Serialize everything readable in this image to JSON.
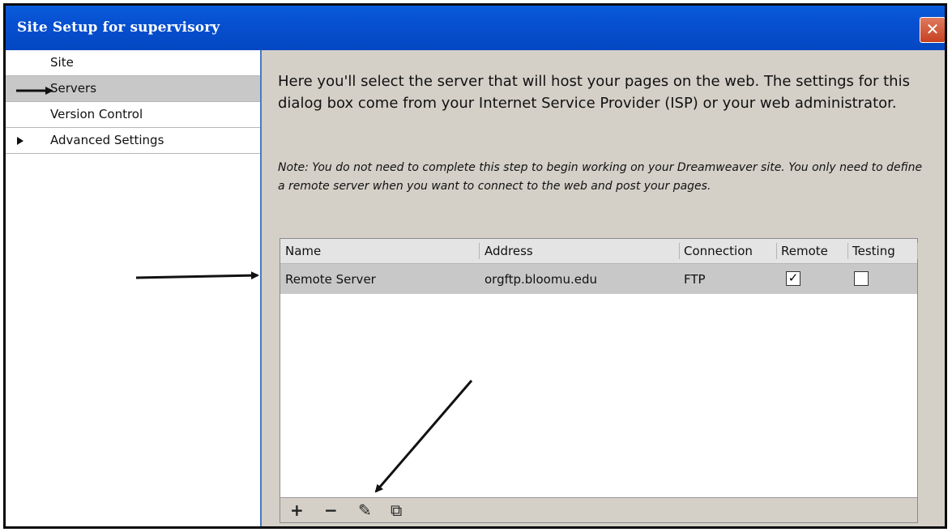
{
  "window": {
    "title": "Site Setup for supervisory",
    "close_glyph": "✕"
  },
  "sidebar": {
    "items": [
      {
        "label": "Site",
        "selected": false,
        "expander": false
      },
      {
        "label": "Servers",
        "selected": true,
        "expander": false
      },
      {
        "label": "Version Control",
        "selected": false,
        "expander": false
      },
      {
        "label": "Advanced Settings",
        "selected": false,
        "expander": true
      }
    ]
  },
  "main": {
    "intro": "Here you'll select the server that will host your pages on the web. The settings for this dialog box come from your Internet Service Provider (ISP) or your web administrator.",
    "note": "Note: You do not need to complete this step to begin working on your Dreamweaver site. You only need to define a remote server when you want to connect to the web and post your pages."
  },
  "servers_table": {
    "columns": [
      "Name",
      "Address",
      "Connection",
      "Remote",
      "Testing"
    ],
    "rows": [
      {
        "name": "Remote Server",
        "address": "orgftp.bloomu.edu",
        "connection": "FTP",
        "remote": true,
        "testing": false
      }
    ]
  },
  "toolbar": {
    "add": "+",
    "remove": "−",
    "edit": "✎",
    "duplicate": "⧉"
  },
  "annotations": {
    "arrow_color": "#111111"
  }
}
